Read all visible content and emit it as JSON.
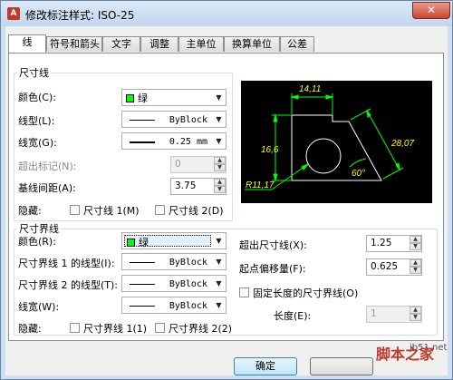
{
  "window": {
    "title": "修改标注样式: ISO-25",
    "close_glyph": "✕"
  },
  "tabs": [
    {
      "label": "线",
      "active": true
    },
    {
      "label": "符号和箭头"
    },
    {
      "label": "文字"
    },
    {
      "label": "调整"
    },
    {
      "label": "主单位"
    },
    {
      "label": "换算单位"
    },
    {
      "label": "公差"
    }
  ],
  "dimension_lines": {
    "group_label": "尺寸线",
    "color": {
      "label": "颜色(C):",
      "value": "绿",
      "swatch": "#00ff00"
    },
    "linetype": {
      "label": "线型(L):",
      "value": "ByBlock"
    },
    "lineweight": {
      "label": "线宽(G):",
      "value": "0.25 mm"
    },
    "extend_ticks": {
      "label": "超出标记(N):",
      "value": "0"
    },
    "baseline_spacing": {
      "label": "基线间距(A):",
      "value": "3.75"
    },
    "suppress": {
      "label": "隐藏:",
      "opt1": "尺寸线 1(M)",
      "opt2": "尺寸线 2(D)"
    }
  },
  "extension_lines": {
    "group_label": "尺寸界线",
    "color": {
      "label": "颜色(R):",
      "value": "绿",
      "swatch": "#00ff00"
    },
    "linetype1": {
      "label": "尺寸界线 1 的线型(I):",
      "value": "ByBlock"
    },
    "linetype2": {
      "label": "尺寸界线 2 的线型(T):",
      "value": "ByBlock"
    },
    "lineweight": {
      "label": "线宽(W):",
      "value": "ByBlock"
    },
    "suppress": {
      "label": "隐藏:",
      "opt1": "尺寸界线 1(1)",
      "opt2": "尺寸界线 2(2)"
    },
    "extend_beyond": {
      "label": "超出尺寸线(X):",
      "value": "1.25"
    },
    "offset_origin": {
      "label": "起点偏移量(F):",
      "value": "0.625"
    },
    "fixed_length": {
      "label": "固定长度的尺寸界线(O)",
      "checked": false
    },
    "length": {
      "label": "长度(E):",
      "value": "1"
    }
  },
  "preview": {
    "dims": [
      "14,11",
      "16,6",
      "28,07",
      "60°",
      "R11,17"
    ],
    "colors": {
      "geometry": "#ffffff",
      "dimensions": "#00ff00",
      "text": "#ffff00"
    }
  },
  "buttons": {
    "ok": "确定"
  },
  "watermark": {
    "text": "脚本之家",
    "site": "jb51.net"
  }
}
